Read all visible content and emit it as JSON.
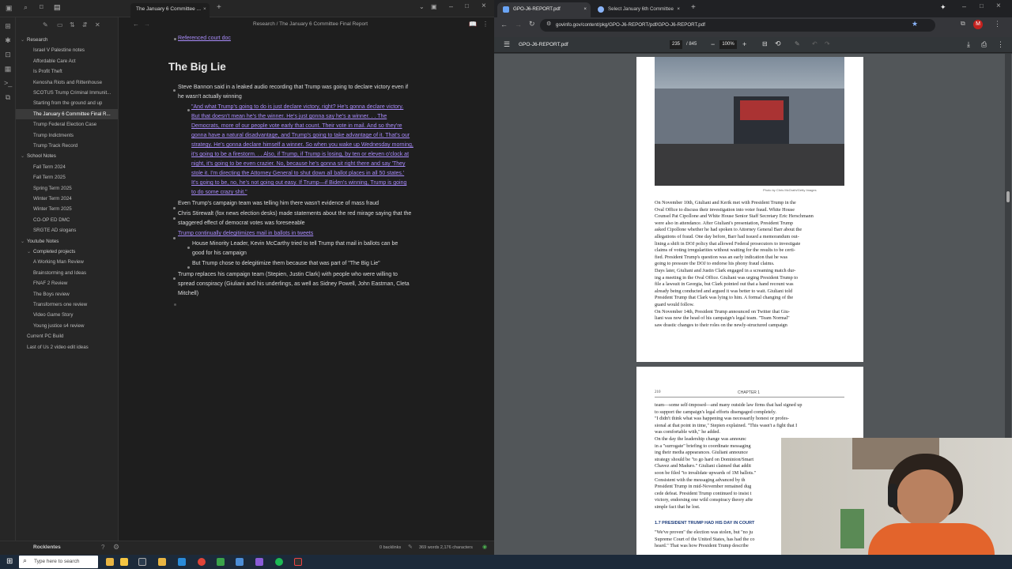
{
  "obsidian": {
    "tab_title": "The January 6 Committee ...",
    "breadcrumb": "Research / The January 6 Committee Final Report",
    "vault_name": "Rocklentes",
    "status": {
      "backlinks": "0 backlinks",
      "counts": "369 words  2,176 characters"
    },
    "filetree": [
      {
        "label": "Research",
        "type": "folder",
        "depth": 0
      },
      {
        "label": "Israel V Palestine notes",
        "type": "file",
        "depth": 1
      },
      {
        "label": "Affordable Care Act",
        "type": "file",
        "depth": 1
      },
      {
        "label": "Is Profit Theft",
        "type": "file",
        "depth": 1
      },
      {
        "label": "Kenosha Riots and Rittenhouse",
        "type": "file",
        "depth": 1
      },
      {
        "label": "SCOTUS Trump Criminal Immunit...",
        "type": "file",
        "depth": 1
      },
      {
        "label": "Starting from the ground and up",
        "type": "file",
        "depth": 1
      },
      {
        "label": "The January 6 Committee Final R...",
        "type": "file",
        "depth": 1,
        "active": true
      },
      {
        "label": "Trump Federal Election Case",
        "type": "file",
        "depth": 1
      },
      {
        "label": "Trump Indictments",
        "type": "file",
        "depth": 1
      },
      {
        "label": "Trump Track Record",
        "type": "file",
        "depth": 1
      },
      {
        "label": "School Notes",
        "type": "folder",
        "depth": 0
      },
      {
        "label": "Fall Term 2024",
        "type": "file",
        "depth": 1
      },
      {
        "label": "Fall Term 2025",
        "type": "file",
        "depth": 1
      },
      {
        "label": "Spring Term 2025",
        "type": "file",
        "depth": 1
      },
      {
        "label": "Winter Term 2024",
        "type": "file",
        "depth": 1
      },
      {
        "label": "Winter Term 2025",
        "type": "file",
        "depth": 1
      },
      {
        "label": "CO-OP ED DMC",
        "type": "file",
        "depth": 1
      },
      {
        "label": "SRGTE AD slogans",
        "type": "file",
        "depth": 1
      },
      {
        "label": "Youtube Notes",
        "type": "folder",
        "depth": 0
      },
      {
        "label": "Completed projects",
        "type": "folder",
        "depth": 1
      },
      {
        "label": "A Working Man Review",
        "type": "file",
        "depth": 1
      },
      {
        "label": "Brainstorming and Ideas",
        "type": "file",
        "depth": 1
      },
      {
        "label": "FNAF 2 Review",
        "type": "file",
        "depth": 1
      },
      {
        "label": "The Boys review",
        "type": "file",
        "depth": 1
      },
      {
        "label": "Transformers one review",
        "type": "file",
        "depth": 1
      },
      {
        "label": "Video Game Story",
        "type": "file",
        "depth": 1
      },
      {
        "label": "Young justice s4 review",
        "type": "file",
        "depth": 1
      },
      {
        "label": "Current PC Build",
        "type": "file",
        "depth": 0
      },
      {
        "label": "Last of Us 2 video edit ideas",
        "type": "file",
        "depth": 0
      }
    ],
    "note": {
      "prev_link": "Referenced court doc",
      "heading": "The Big Lie",
      "b1_l1": "Steve Bannon said in a leaked audio recording that Trump was going to declare victory even if",
      "b1_l2": "he wasn't actually winning",
      "quote": [
        "\"And what Trump's going to do is just declare victory, right? He's gonna declare victory.",
        "But that doesn't mean he's the winner. He's just gonna say he's a winner. . . The",
        "Democrats, more of our people vote early that count. Their vote in mail. And so they're",
        "gonna have a natural disadvantage, and Trump's going to take advantage of it. That's our",
        "strategy. He's gonna declare himself a winner. So when you wake up Wednesday morning,",
        "it's going to be a firestorm. . . Also, if Trump, if Trump is losing, by ten or eleven o'clock at",
        "night, it's going to be even crazier. No, because he's gonna sit right there and say 'They",
        "stole it. I'm directing the Attorney General to shut down all ballot places in all 50 states.'",
        "It's going to be, no, he's not going out easy. If Trump—if Biden's winning, Trump is going",
        "to do some crazy shit.\""
      ],
      "b2": "Even Trump's campaign team was telling him there wasn't evidence of mass fraud",
      "b3_l1": "Chris Stirewalt (fox news election desks) made statements about the red mirage saying that the",
      "b3_l2": "staggered effect of democrat votes was foreseeable",
      "b4": "Trump continually delegitimizes mail in ballots in tweets",
      "b4a_l1": "House Minority Leader, Kevin McCarthy tried to tell Trump that mail in ballots can be",
      "b4a_l2": "good for his campaign",
      "b4b": "But Trump chose to delegitimize them because that was part of \"The Big Lie\"",
      "b5_l1": "Trump replaces his campaign team (Stepien, Justin Clark) with people who were willing to",
      "b5_l2": "spread conspiracy (Giuliani and his underlings, as well as Sidney Powell, John Eastman, Cleta",
      "b5_l3": "Mitchell)"
    }
  },
  "chrome": {
    "tab1": "GPO-J6-REPORT.pdf",
    "tab2": "Select January 6th Committee ...",
    "url": "govinfo.gov/content/pkg/GPO-J6-REPORT/pdf/GPO-J6-REPORT.pdf",
    "pdf_title": "GPO-J6-REPORT.pdf",
    "page_current": "235",
    "page_total": "/ 845",
    "zoom": "100%",
    "avatar_letter": "M"
  },
  "pdf": {
    "photo_credit": "Photo by Chris McGrath/Getty Images",
    "page1_text": [
      "On November 10th, Giuliani and Kerik met with President Trump in the",
      "Oval Office to discuss their investigation into voter fraud. White House",
      "Counsel Pat Cipollone and White House Senior Staff Secretary Eric Herschmann",
      "were also in attendance. After Giuliani's presentation, President Trump",
      "asked Cipollone whether he had spoken to Attorney General Barr about the",
      "allegations of fraud. One day before, Barr had issued a memorandum out-",
      "lining a shift in DOJ policy that allowed Federal prosecutors to investigate",
      "claims of voting irregularities without waiting for the results to be certi-",
      "fied. President Trump's question was an early indication that he was",
      "going to pressure the DOJ to endorse his phony fraud claims.",
      "Days later, Giuliani and Justin Clark engaged in a screaming match dur-",
      "ing a meeting in the Oval Office. Giuliani was urging President Trump to",
      "file a lawsuit in Georgia, but Clark pointed out that a hand recount was",
      "already being conducted and argued it was better to wait. Giuliani told",
      "President Trump that Clark was lying to him. A formal changing of the",
      "guard would follow.",
      "On November 14th, President Trump announced on Twitter that Giu-",
      "liani was now the head of his campaign's legal team. \"Team Normal\"",
      "saw drastic changes to their roles on the newly-structured campaign"
    ],
    "page2_number": "210",
    "page2_chapter": "CHAPTER 1",
    "page2_text": [
      "team—some self-imposed—and many outside law firms that had signed up",
      "to support the campaign's legal efforts disengaged completely.",
      "\"I didn't think what was happening was necessarily honest or profes-",
      "sional at that point in time,\" Stepien explained. \"This wasn't a fight that I",
      "was comfortable with,\" he added.",
      "On the day the leadership change was announc",
      "in a \"surrogate\" briefing to coordinate messaging",
      "ing their media appearances. Giuliani announce",
      "strategy should be \"to go hard on Dominion/Smart",
      "Chavez and Maduro.\" Giuliani claimed that addit",
      "soon be filed \"to invalidate upwards of 1M ballots.\"",
      "Consistent with the messaging advanced by th",
      "President Trump in mid-November remained dug",
      "cede defeat. President Trump continued to insist t",
      "victory, endorsing one wild conspiracy theory afte",
      "simple fact that he lost."
    ],
    "section_heading": "1.7   PRESIDENT TRUMP HAD HIS DAY IN COURT",
    "page2_tail": [
      "\"We've proven\" the election was stolen, but \"no ju",
      "Supreme Court of the United States, has had the co",
      "heard.\" That was how President Trump describe"
    ]
  },
  "taskbar": {
    "search_placeholder": "Type here to search"
  }
}
